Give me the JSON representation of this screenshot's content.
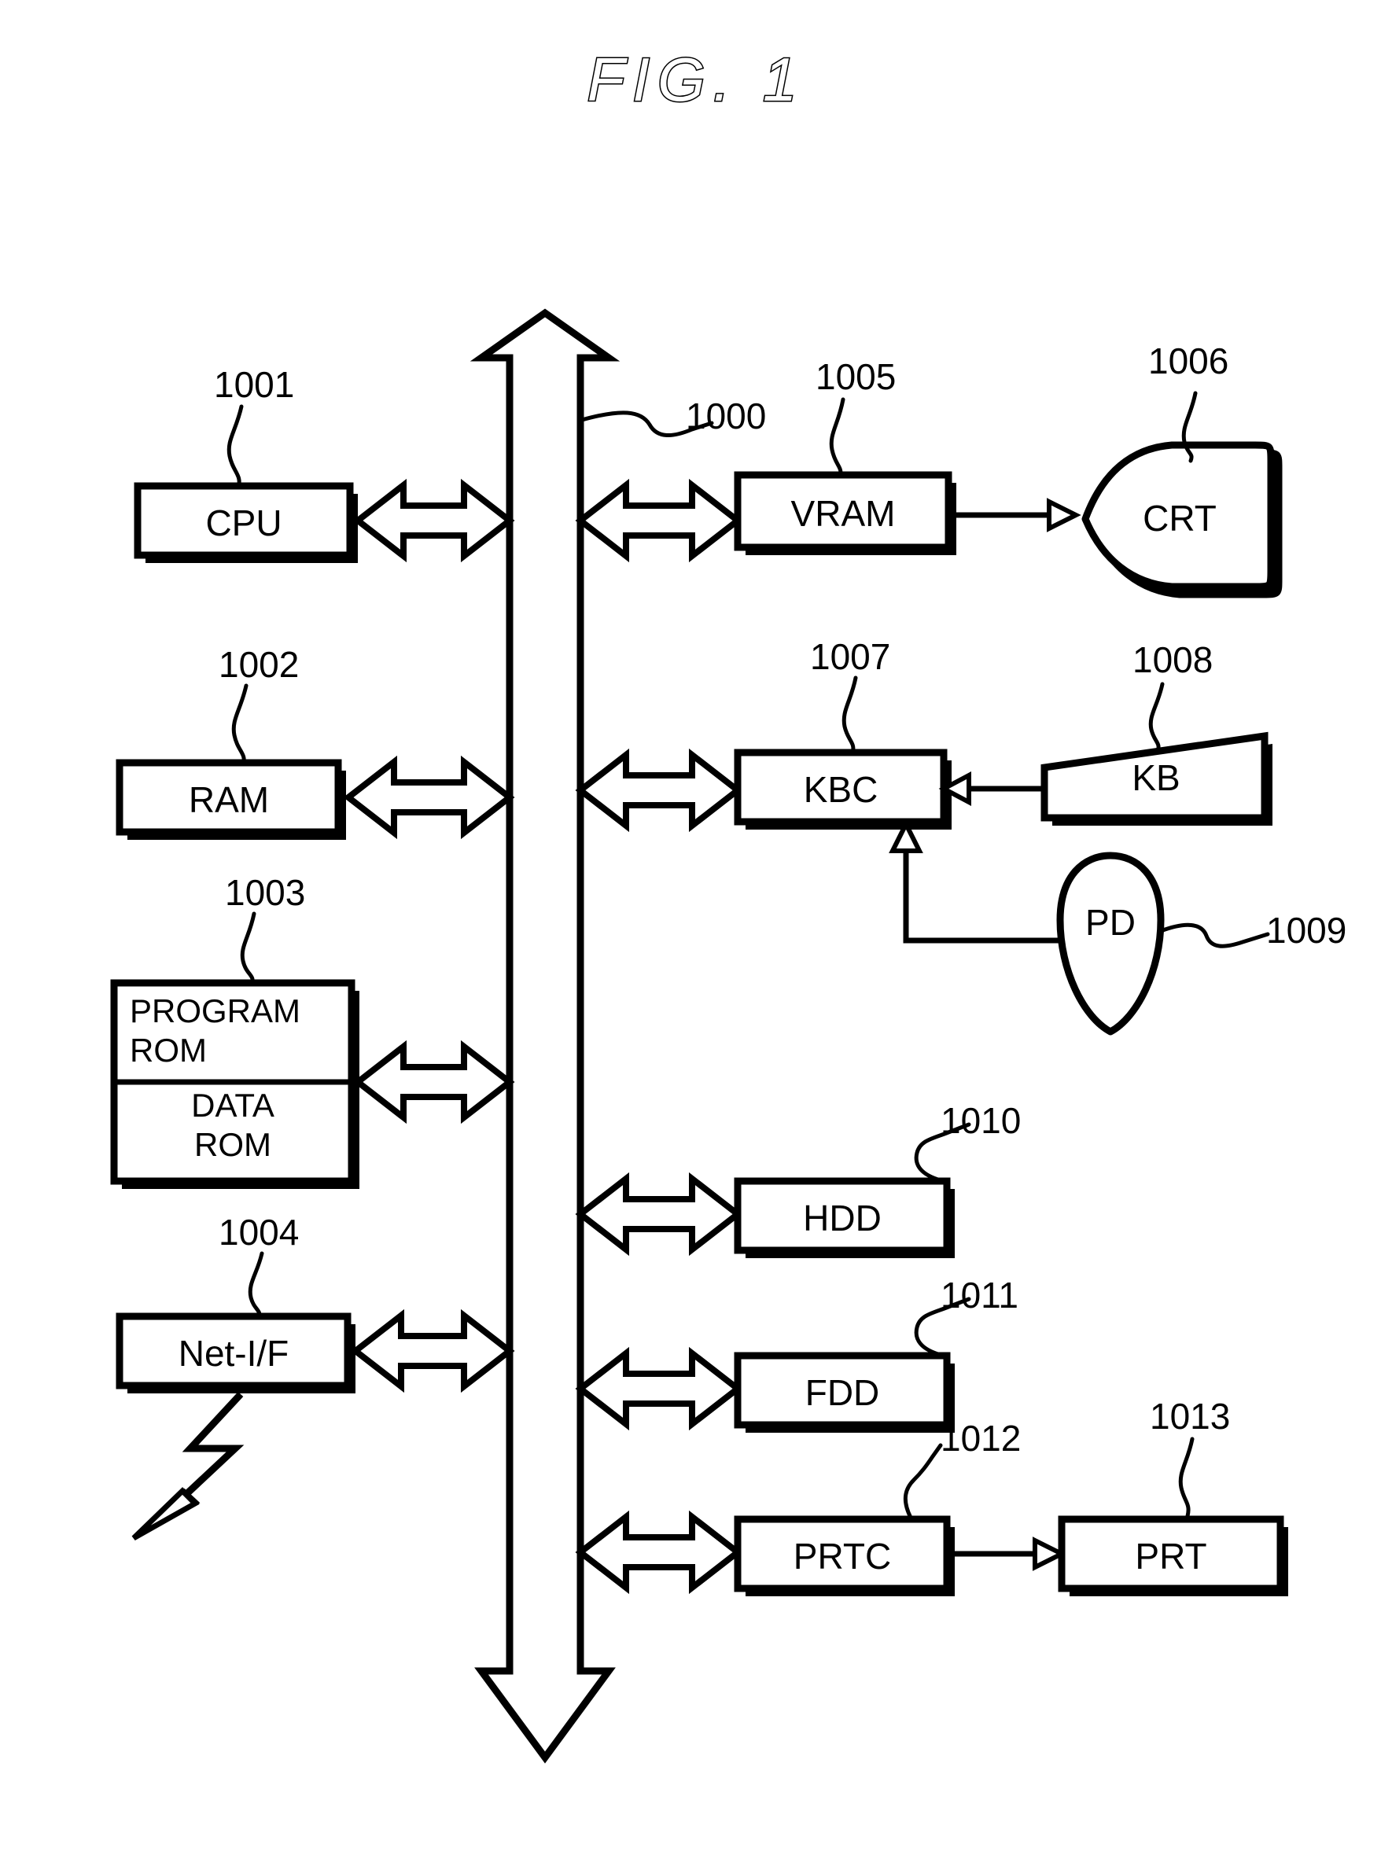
{
  "figure": {
    "title": "FIG.  1",
    "kind": "block-diagram",
    "subject": "computer system hardware block diagram"
  },
  "colors": {
    "line": "#000000",
    "background": "#ffffff",
    "text": "#000000"
  },
  "bus": {
    "ref": "1000",
    "name": "system-bus",
    "description": "vertical double-headed hollow bus arrow"
  },
  "blocks": [
    {
      "id": "cpu",
      "label": "CPU",
      "ref": "1001",
      "shape": "rect-shadow",
      "side": "left"
    },
    {
      "id": "ram",
      "label": "RAM",
      "ref": "1002",
      "shape": "rect-shadow",
      "side": "left"
    },
    {
      "id": "program-rom",
      "label": "PROGRAM ROM",
      "ref": "1003",
      "shape": "rect-shadow",
      "side": "left"
    },
    {
      "id": "data-rom",
      "label": "DATA ROM",
      "ref": "",
      "shape": "rect-shadow",
      "side": "left"
    },
    {
      "id": "net-if",
      "label": "Net-I/F",
      "ref": "1004",
      "shape": "rect-shadow",
      "side": "left"
    },
    {
      "id": "vram",
      "label": "VRAM",
      "ref": "1005",
      "shape": "rect-shadow",
      "side": "right"
    },
    {
      "id": "crt",
      "label": "CRT",
      "ref": "1006",
      "shape": "crt-silhouette",
      "side": "right"
    },
    {
      "id": "kbc",
      "label": "KBC",
      "ref": "1007",
      "shape": "rect-shadow",
      "side": "right"
    },
    {
      "id": "kb",
      "label": "KB",
      "ref": "1008",
      "shape": "trapezoid",
      "side": "right"
    },
    {
      "id": "pd",
      "label": "PD",
      "ref": "1009",
      "shape": "mouse-outline",
      "side": "right"
    },
    {
      "id": "hdd",
      "label": "HDD",
      "ref": "1010",
      "shape": "rect-shadow",
      "side": "right"
    },
    {
      "id": "fdd",
      "label": "FDD",
      "ref": "1011",
      "shape": "rect-shadow",
      "side": "right"
    },
    {
      "id": "prtc",
      "label": "PRTC",
      "ref": "1012",
      "shape": "rect-shadow",
      "side": "right"
    },
    {
      "id": "prt",
      "label": "PRT",
      "ref": "1013",
      "shape": "rect-shadow",
      "side": "right"
    }
  ],
  "ref_numbers": {
    "bus": "1000",
    "cpu": "1001",
    "ram": "1002",
    "rom": "1003",
    "net_if": "1004",
    "vram": "1005",
    "crt": "1006",
    "kbc": "1007",
    "kb": "1008",
    "pd": "1009",
    "hdd": "1010",
    "fdd": "1011",
    "prtc": "1012",
    "prt": "1013"
  },
  "labels": {
    "cpu": "CPU",
    "ram": "RAM",
    "program_rom_line1": "PROGRAM",
    "program_rom_line2": "ROM",
    "data_rom_line1": "DATA",
    "data_rom_line2": "ROM",
    "net_if": "Net-I/F",
    "vram": "VRAM",
    "crt": "CRT",
    "kbc": "KBC",
    "kb": "KB",
    "pd": "PD",
    "hdd": "HDD",
    "fdd": "FDD",
    "prtc": "PRTC",
    "prt": "PRT"
  },
  "connections": [
    {
      "from": "cpu",
      "to": "bus",
      "type": "bidirectional-hollow-arrow"
    },
    {
      "from": "ram",
      "to": "bus",
      "type": "bidirectional-hollow-arrow"
    },
    {
      "from": "rom",
      "to": "bus",
      "type": "bidirectional-hollow-arrow"
    },
    {
      "from": "net-if",
      "to": "bus",
      "type": "bidirectional-hollow-arrow"
    },
    {
      "from": "bus",
      "to": "vram",
      "type": "bidirectional-hollow-arrow"
    },
    {
      "from": "bus",
      "to": "kbc",
      "type": "bidirectional-hollow-arrow"
    },
    {
      "from": "bus",
      "to": "hdd",
      "type": "bidirectional-hollow-arrow"
    },
    {
      "from": "bus",
      "to": "fdd",
      "type": "bidirectional-hollow-arrow"
    },
    {
      "from": "bus",
      "to": "prtc",
      "type": "bidirectional-hollow-arrow"
    },
    {
      "from": "vram",
      "to": "crt",
      "type": "single-open-arrow"
    },
    {
      "from": "kb",
      "to": "kbc",
      "type": "single-open-arrow"
    },
    {
      "from": "pd",
      "to": "kbc",
      "type": "single-open-arrow-elbow"
    },
    {
      "from": "prtc",
      "to": "prt",
      "type": "single-open-arrow"
    },
    {
      "from": "net-if",
      "to": "network",
      "type": "lightning-bolt-arrow"
    }
  ]
}
